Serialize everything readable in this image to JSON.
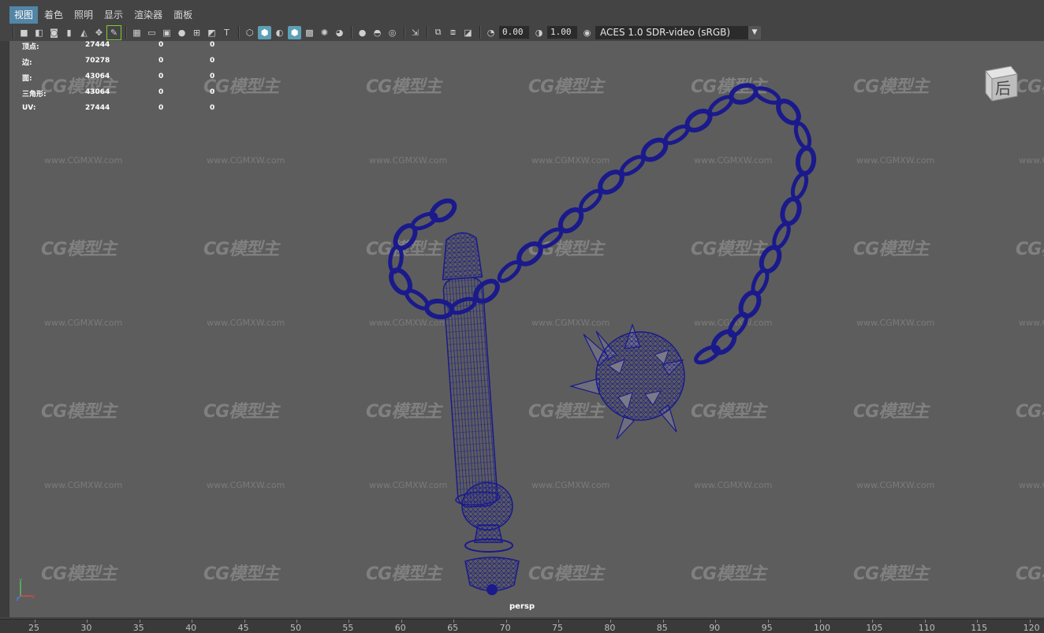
{
  "menubar": {
    "items": [
      "视图",
      "着色",
      "照明",
      "显示",
      "渲染器",
      "面板"
    ],
    "active_index": 0
  },
  "toolbar": {
    "exposure_value": "0.00",
    "gamma_value": "1.00",
    "color_space": "ACES 1.0 SDR-video (sRGB)"
  },
  "hud": {
    "rows": [
      {
        "label": "顶点:",
        "v1": "27444",
        "v2": "0",
        "v3": "0"
      },
      {
        "label": "边:",
        "v1": "70278",
        "v2": "0",
        "v3": "0"
      },
      {
        "label": "面:",
        "v1": "43064",
        "v2": "0",
        "v3": "0"
      },
      {
        "label": "三角形:",
        "v1": "43064",
        "v2": "0",
        "v3": "0"
      },
      {
        "label": "UV:",
        "v1": "27444",
        "v2": "0",
        "v3": "0"
      }
    ]
  },
  "viewcube": {
    "label": "后"
  },
  "camera_label": "persp",
  "axis": {
    "x": "x",
    "y": "y",
    "z": "z"
  },
  "watermark": {
    "logo": "CG模型主",
    "url": "www.CGMXW.com"
  },
  "timeline": {
    "ticks": [
      "25",
      "30",
      "35",
      "40",
      "45",
      "50",
      "55",
      "60",
      "65",
      "70",
      "75",
      "80",
      "85",
      "90",
      "95",
      "100",
      "105",
      "110",
      "115",
      "120"
    ]
  },
  "colors": {
    "viewport_bg": "#5d5d5d",
    "wireframe": "#1a1a8c",
    "menu_active": "#5285a6"
  }
}
